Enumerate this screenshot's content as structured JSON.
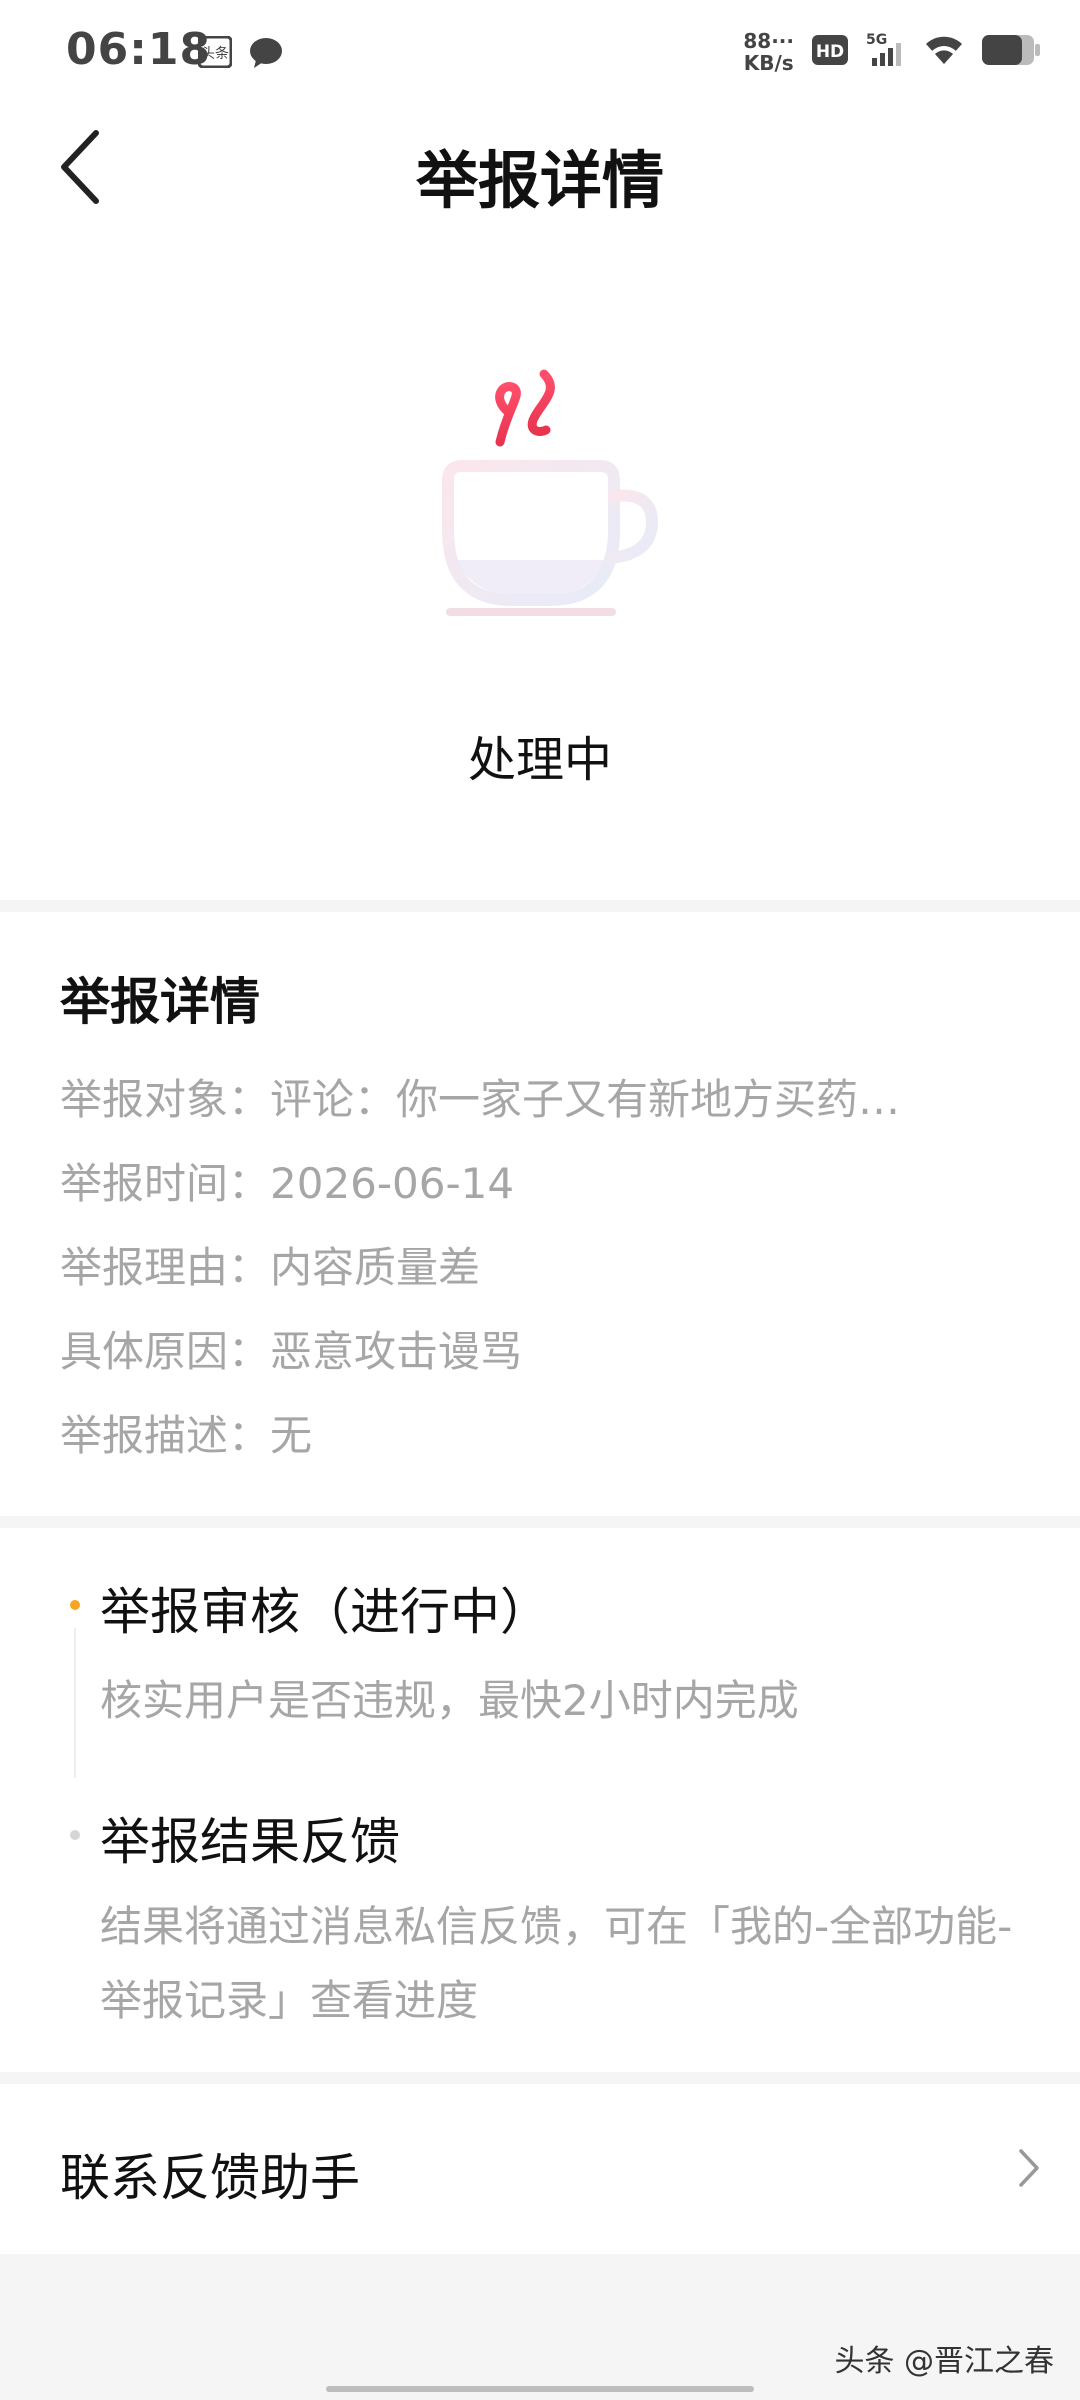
{
  "status_bar": {
    "time": "06:18",
    "net_speed_value": "88···",
    "net_speed_unit": "KB/s",
    "hd_label": "HD",
    "signal_label": "5G",
    "toutiao_label": "头条"
  },
  "nav": {
    "title": "举报详情"
  },
  "hero": {
    "status": "处理中",
    "icon": "coffee-cup-icon"
  },
  "details": {
    "title": "举报详情",
    "rows": [
      "举报对象：评论：你一家子又有新地方买药…",
      "举报时间：2026-06-14",
      "举报理由：内容质量差",
      "具体原因：恶意攻击谩骂",
      "举报描述：无"
    ]
  },
  "progress": {
    "steps": [
      {
        "title": "举报审核（进行中）",
        "desc": "核实用户是否违规，最快2小时内完成",
        "active": true
      },
      {
        "title": "举报结果反馈",
        "desc": "结果将通过消息私信反馈，可在「我的-全部功能-举报记录」查看进度",
        "active": false
      }
    ]
  },
  "contact": {
    "label": "联系反馈助手"
  },
  "watermark": "头条 @晋江之春",
  "colors": {
    "accent_orange": "#f5a623",
    "inactive_dot": "#d6d6d6",
    "steam_red": "#ff4f6b",
    "muted_text": "#a6a6a6"
  }
}
